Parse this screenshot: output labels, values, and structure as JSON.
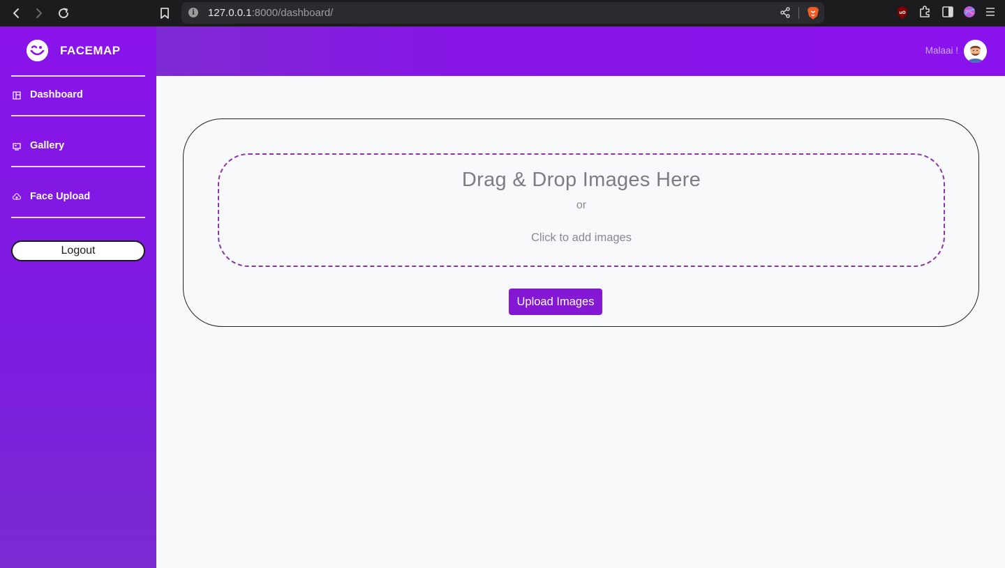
{
  "browser": {
    "url_host": "127.0.0.1",
    "url_rest": ":8000/dashboard/"
  },
  "sidebar": {
    "brand": "FACEMAP",
    "items": [
      {
        "label": "Dashboard",
        "icon": "dashboard-icon"
      },
      {
        "label": "Gallery",
        "icon": "gallery-icon"
      },
      {
        "label": "Face Upload",
        "icon": "cloud-upload-icon"
      }
    ],
    "logout_label": "Logout"
  },
  "header": {
    "user_name": "Malaai !"
  },
  "upload": {
    "drop_title": "Drag & Drop Images Here",
    "or_text": "or",
    "click_text": "Click to add images",
    "button_label": "Upload Images"
  },
  "colors": {
    "primary": "#8418d4",
    "sidebar": "#8a13ea",
    "dropzone_border": "#8a35a6"
  }
}
